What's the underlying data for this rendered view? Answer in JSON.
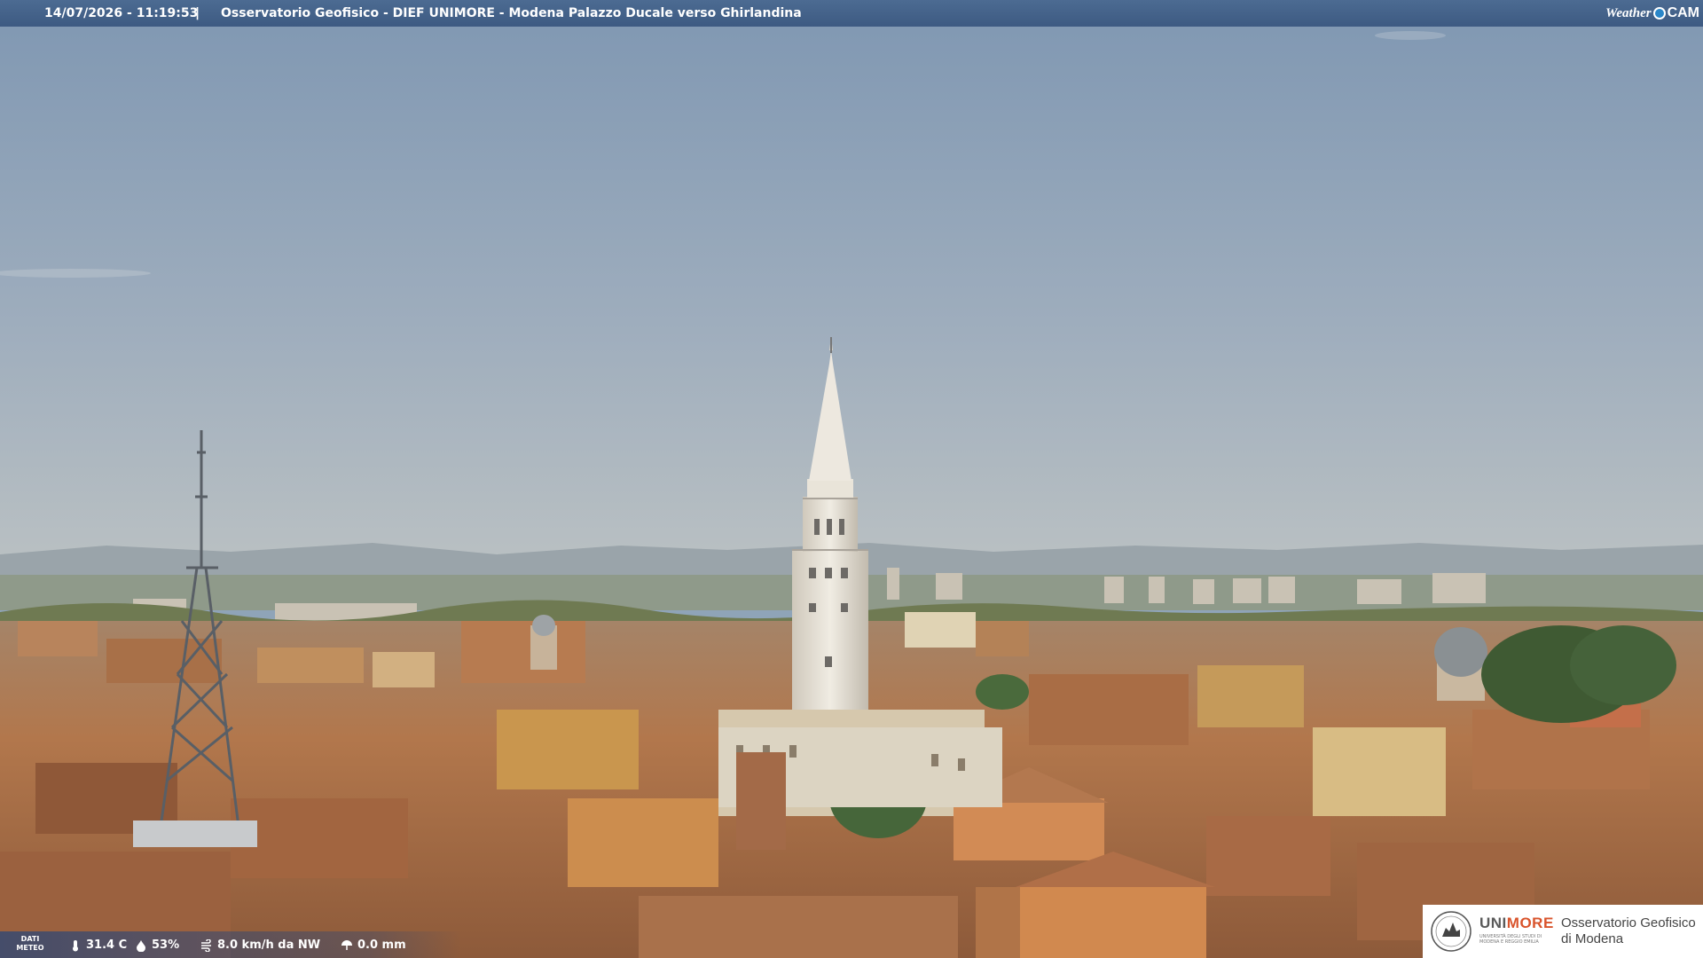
{
  "header": {
    "timestamp": "14/07/2026 - 11:19:53",
    "separator": "|",
    "title": "Osservatorio Geofisico - DIEF UNIMORE - Modena Palazzo Ducale verso Ghirlandina",
    "brand_weather": "Weather",
    "brand_cam": "CAM"
  },
  "meteo": {
    "label_line1": "DATI",
    "label_line2": "METEO",
    "temperature": "31.4 C",
    "humidity": "53%",
    "wind": "8.0 km/h da NW",
    "rain": "0.0 mm"
  },
  "logo": {
    "uni_prefix": "UNI",
    "uni_suffix": "MORE",
    "uni_sub": "UNIVERSITÀ DEGLI STUDI DI MODENA E REGGIO EMILIA",
    "obs_line1": "Osservatorio Geofisico",
    "obs_line2": "di Modena"
  },
  "colors": {
    "sky_top": "#7f97b2",
    "sky_bottom": "#b6bdc0",
    "roof": "#b07a52",
    "tower": "#e6e1d6",
    "bar": "#3d5a82",
    "logo_accent": "#d9542c"
  }
}
